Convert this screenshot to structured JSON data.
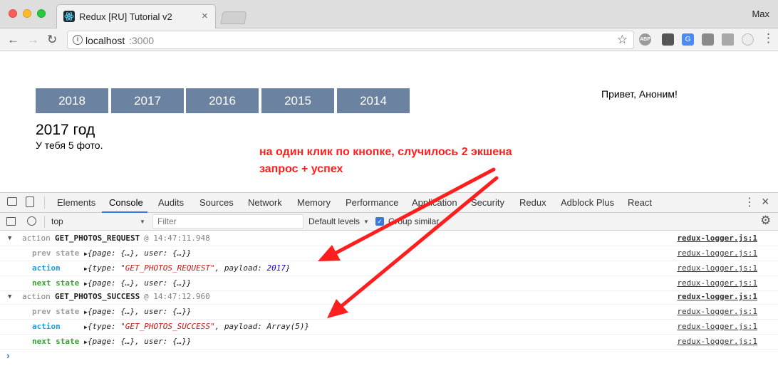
{
  "browser": {
    "tab_title": "Redux [RU] Tutorial v2",
    "profile": "Max",
    "url_host": "localhost",
    "url_port": ":3000"
  },
  "page": {
    "years": [
      "2018",
      "2017",
      "2016",
      "2015",
      "2014"
    ],
    "greeting": "Привет, Аноним!",
    "year_heading": "2017 год",
    "photo_count": "У тебя 5 фото."
  },
  "annotation": {
    "line1": "на один клик по кнопке, случилось 2 экшена",
    "line2": "запрос + успех",
    "color": "#ff1e1e"
  },
  "devtools": {
    "tabs": [
      "Elements",
      "Console",
      "Audits",
      "Sources",
      "Network",
      "Memory",
      "Performance",
      "Application",
      "Security",
      "Redux",
      "Adblock Plus",
      "React"
    ],
    "active_tab": "Console",
    "context": "top",
    "filter_placeholder": "Filter",
    "levels": "Default levels",
    "group_similar": "Group similar",
    "log": {
      "g1_action_word": "action",
      "g1_type": "GET_PHOTOS_REQUEST",
      "g1_time": "@ 14:47:11.948",
      "g2_action_word": "action",
      "g2_type": "GET_PHOTOS_SUCCESS",
      "g2_time": "@ 14:47:12.960",
      "prev_state": "prev state",
      "action": "action",
      "next_state": "next state",
      "state_obj_open": "{page: ",
      "state_page_val": "{…}",
      "state_mid": ", user: ",
      "state_user_val": "{…}",
      "state_close": "}",
      "type_key": "{type: ",
      "req_type_str": "\"GET_PHOTOS_REQUEST\"",
      "payload_key": ", payload: ",
      "req_payload": "2017",
      "succ_type_str": "\"GET_PHOTOS_SUCCESS\"",
      "succ_payload": "Array(5)",
      "obj_close": "}",
      "source": "redux-logger.js:1"
    },
    "prompt": "›"
  }
}
